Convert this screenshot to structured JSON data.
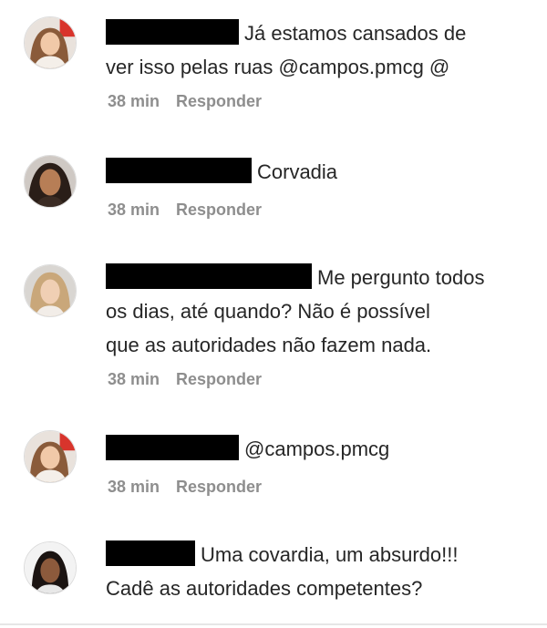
{
  "comments": [
    {
      "text_after_redaction": "Já estamos cansados de",
      "text_line2": "ver isso pelas ruas @campos.pmcg @",
      "time": "38 min",
      "reply_label": "Responder"
    },
    {
      "text_after_redaction": "Corvadia",
      "time": "38 min",
      "reply_label": "Responder"
    },
    {
      "text_after_redaction": "Me pergunto todos",
      "text_line2": "os dias, até quando? Não é possível",
      "text_line3": "que as autoridades não fazem nada.",
      "time": "38 min",
      "reply_label": "Responder"
    },
    {
      "text_after_redaction": "@campos.pmcg",
      "time": "38 min",
      "reply_label": "Responder"
    },
    {
      "text_after_redaction": "Uma covardia, um absurdo!!!",
      "text_line2": "Cadê as autoridades competentes?"
    }
  ],
  "icons": {
    "avatar": "user-avatar-photo",
    "redaction": "redacted-username-bar"
  }
}
